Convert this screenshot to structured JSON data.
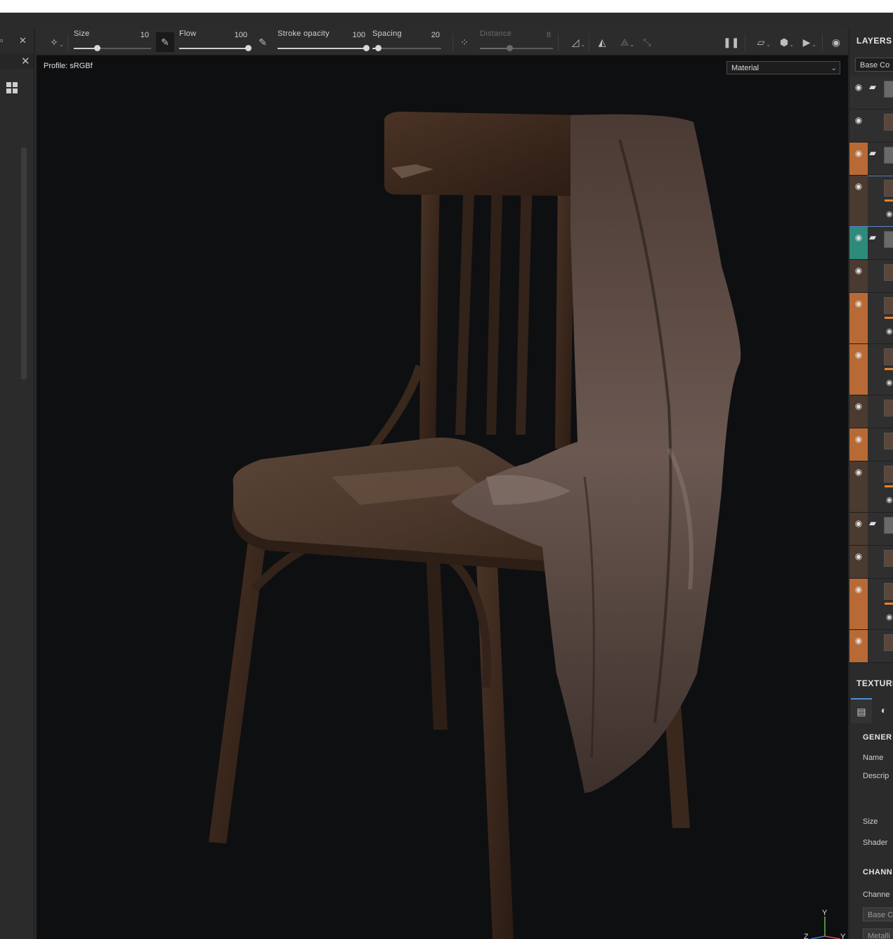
{
  "toolbar": {
    "size_label": "Size",
    "size_value": "10",
    "size_fraction": 0.3,
    "flow_label": "Flow",
    "flow_value": "100",
    "flow_fraction": 1.0,
    "stroke_opacity_label": "Stroke opacity",
    "stroke_opacity_value": "100",
    "stroke_opacity_fraction": 1.0,
    "spacing_label": "Spacing",
    "spacing_value": "20",
    "spacing_fraction": 0.08,
    "distance_label": "Distance",
    "distance_value": "8",
    "distance_fraction": 0.4
  },
  "viewport": {
    "profile_text": "Profile: sRGBf",
    "material_select": "Material",
    "axis_labels": {
      "y": "Y",
      "z": "Z",
      "x": "Y"
    }
  },
  "layers_panel": {
    "title": "LAYERS",
    "channel_select": "Base Co",
    "layers": [
      {
        "tag_color": "#2f2f2f",
        "type": "folder"
      },
      {
        "tag_color": "#2f2f2f",
        "type": "layer"
      },
      {
        "tag_color": "#b86a36",
        "type": "folder"
      },
      {
        "tag_color": "#4a3a30",
        "type": "layer",
        "selected": true
      },
      {
        "tag_color": "#2e8a7b",
        "type": "folder"
      },
      {
        "tag_color": "#4a3a30",
        "type": "layer"
      },
      {
        "tag_color": "#b86a36",
        "type": "layer"
      },
      {
        "tag_color": "#b86a36",
        "type": "layer"
      },
      {
        "tag_color": "#4a3a30",
        "type": "layer"
      },
      {
        "tag_color": "#b86a36",
        "type": "layer"
      },
      {
        "tag_color": "#4a3a30",
        "type": "layer"
      },
      {
        "tag_color": "#4a3a30",
        "type": "folder"
      },
      {
        "tag_color": "#4a3a30",
        "type": "layer"
      },
      {
        "tag_color": "#b86a36",
        "type": "layer"
      },
      {
        "tag_color": "#b86a36",
        "type": "layer"
      }
    ]
  },
  "texture_panel": {
    "title": "TEXTURE",
    "general_section": "GENER",
    "name_label": "Name",
    "description_label": "Descrip",
    "size_label": "Size",
    "shader_label": "Shader",
    "channels_section": "CHANN",
    "channels_label": "Channe",
    "channel_1": "Base C",
    "channel_2": "Metalli"
  },
  "colors": {
    "accent_orange": "#e8822e",
    "selection_blue": "#5a86c8",
    "teal_tag": "#2e8a7b"
  }
}
